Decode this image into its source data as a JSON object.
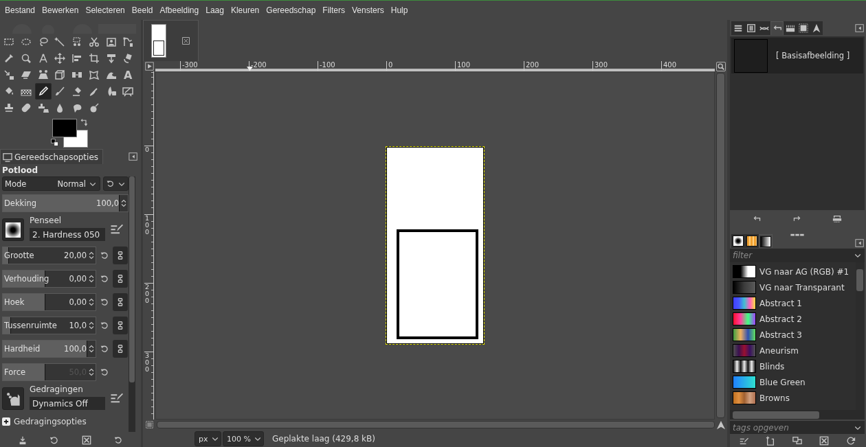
{
  "menu": [
    "Bestand",
    "Bewerken",
    "Selecteren",
    "Beeld",
    "Afbeelding",
    "Laag",
    "Kleuren",
    "Gereedschap",
    "Filters",
    "Vensters",
    "Hulp"
  ],
  "tools": [
    {
      "selected": false
    },
    {
      "selected": false
    },
    {
      "selected": false
    },
    {
      "selected": false
    },
    {
      "selected": false
    },
    {
      "selected": false
    },
    {
      "selected": false
    },
    {
      "selected": false
    },
    {
      "selected": false
    },
    {
      "selected": false
    },
    {
      "selected": false
    },
    {
      "selected": false
    },
    {
      "selected": false
    },
    {
      "selected": false
    },
    {
      "selected": false
    },
    {
      "selected": false
    },
    {
      "selected": false
    },
    {
      "selected": false
    },
    {
      "selected": false
    },
    {
      "selected": false
    },
    {
      "selected": false
    },
    {
      "selected": false
    },
    {
      "selected": false
    },
    {
      "selected": false,
      "glyph": "A"
    },
    {
      "selected": false
    },
    {
      "selected": false
    },
    {
      "selected": true
    },
    {
      "selected": false
    },
    {
      "selected": false
    },
    {
      "selected": false
    },
    {
      "selected": false
    },
    {
      "selected": false
    },
    {
      "selected": false
    },
    {
      "selected": false
    },
    {
      "selected": false
    },
    {
      "selected": false
    },
    {
      "selected": false
    },
    {
      "selected": false
    }
  ],
  "tool_options": {
    "tab": "Gereedschapsopties",
    "title": "Potlood",
    "mode": {
      "label": "Mode",
      "value": "Normal"
    },
    "opacity": {
      "label": "Dekking",
      "value": "100,0",
      "level": 1
    },
    "brush": {
      "label": "Penseel",
      "value": "2. Hardness 050"
    },
    "sliders": [
      {
        "kind": "linked",
        "label": "Grootte",
        "value": "20,00",
        "level": 0.07,
        "disabled": false
      },
      {
        "kind": "linked",
        "label": "Verhouding",
        "value": "0,00",
        "level": 0.5,
        "disabled": false
      },
      {
        "kind": "linked",
        "label": "Hoek",
        "value": "0,00",
        "level": 0.5,
        "disabled": false
      },
      {
        "kind": "linked",
        "label": "Tussenruimte",
        "value": "10,0",
        "level": 0.1,
        "disabled": false
      },
      {
        "kind": "linked",
        "label": "Hardheid",
        "value": "100,0",
        "level": 1,
        "disabled": false
      },
      {
        "kind": "reset",
        "label": "Force",
        "value": "50,0",
        "level": 0.5,
        "disabled": true
      }
    ],
    "dynamics": {
      "label": "Gedragingen",
      "value": "Dynamics Off"
    },
    "dynamics_options": {
      "label": "Gedragingsopties",
      "expanded": false
    }
  },
  "image_tabs": [
    {
      "selected": true
    }
  ],
  "rulers": {
    "horizontal": [
      "-300",
      "-200",
      "-100",
      "0",
      "100",
      "200",
      "300",
      "400"
    ],
    "vertical": [
      "0",
      "100",
      "200",
      "300"
    ]
  },
  "status_bar": {
    "unit": "px",
    "zoom": "100 %",
    "message": "Geplakte laag (429,8 kB)"
  },
  "dock_tabs": [
    {
      "selected": false
    },
    {
      "selected": false
    },
    {
      "selected": false
    },
    {
      "selected": true
    },
    {
      "selected": false
    },
    {
      "selected": false
    },
    {
      "selected": false
    }
  ],
  "history": [
    {
      "label": "[ Basisafbeelding ]",
      "selected": true
    }
  ],
  "resource_tabs": [
    {
      "selected": false
    },
    {
      "selected": false
    },
    {
      "selected": true
    }
  ],
  "gradients": {
    "filter_placeholder": "filter",
    "tags_placeholder": "tags opgeven",
    "items": [
      {
        "name": "VG naar AG (RGB) #1"
      },
      {
        "name": "VG naar Transparant"
      },
      {
        "name": "Abstract 1"
      },
      {
        "name": "Abstract 2"
      },
      {
        "name": "Abstract 3"
      },
      {
        "name": "Aneurism"
      },
      {
        "name": "Blinds"
      },
      {
        "name": "Blue Green"
      },
      {
        "name": "Browns"
      }
    ]
  }
}
